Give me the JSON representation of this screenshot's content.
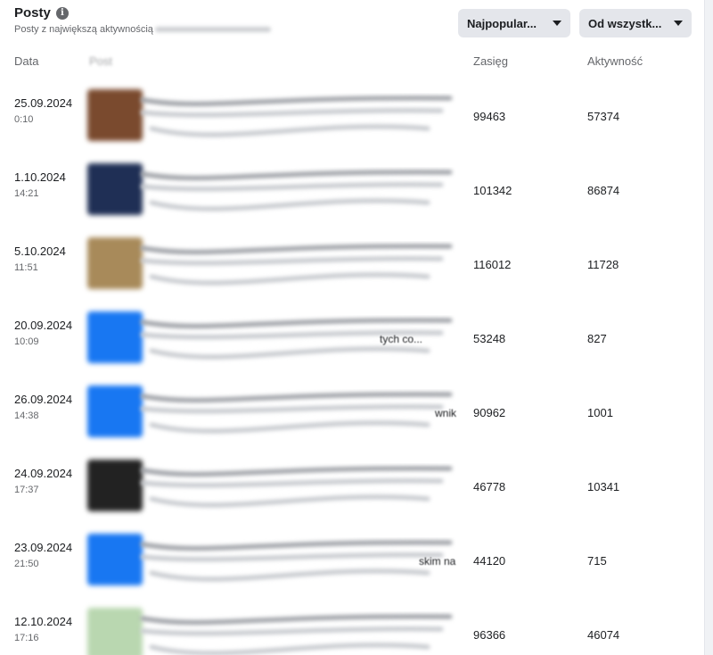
{
  "header": {
    "title": "Posty",
    "subtitle": "Posty z największą aktywnością"
  },
  "filters": {
    "sort_label": "Najpopular...",
    "range_label": "Od wszystk..."
  },
  "columns": {
    "date": "Data",
    "post": "Post",
    "reach": "Zasięg",
    "activity": "Aktywność"
  },
  "rows": [
    {
      "date": "25.09.2024",
      "time": "0:10",
      "reach": "99463",
      "activity": "57374",
      "snippet": "",
      "thumb_color": "#7a4a2e"
    },
    {
      "date": "1.10.2024",
      "time": "14:21",
      "reach": "101342",
      "activity": "86874",
      "snippet": "",
      "thumb_color": "#1f2f55"
    },
    {
      "date": "5.10.2024",
      "time": "11:51",
      "reach": "116012",
      "activity": "11728",
      "snippet": "",
      "thumb_color": "#a88a5a"
    },
    {
      "date": "20.09.2024",
      "time": "10:09",
      "reach": "53248",
      "activity": "827",
      "snippet": "tych co...",
      "thumb_color": "#1877f2"
    },
    {
      "date": "26.09.2024",
      "time": "14:38",
      "reach": "90962",
      "activity": "1001",
      "snippet": "wnik",
      "thumb_color": "#1877f2"
    },
    {
      "date": "24.09.2024",
      "time": "17:37",
      "reach": "46778",
      "activity": "10341",
      "snippet": "",
      "thumb_color": "#222222"
    },
    {
      "date": "23.09.2024",
      "time": "21:50",
      "reach": "44120",
      "activity": "715",
      "snippet": "skim na",
      "thumb_color": "#1877f2"
    },
    {
      "date": "12.10.2024",
      "time": "17:16",
      "reach": "96366",
      "activity": "46074",
      "snippet": "",
      "thumb_color": "#b9d7b0"
    }
  ]
}
